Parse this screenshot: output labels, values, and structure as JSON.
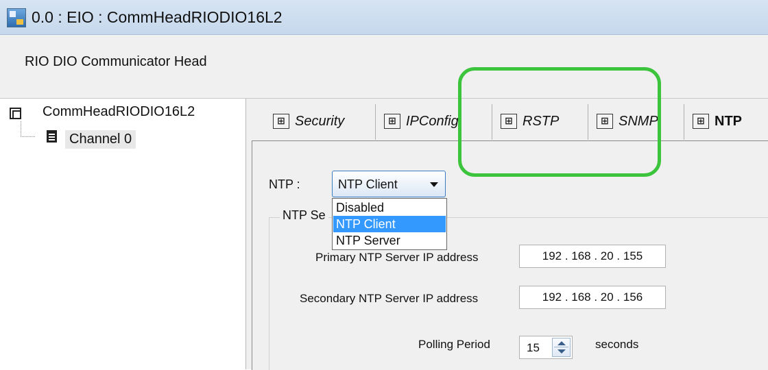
{
  "window": {
    "title": "0.0 : EIO : CommHeadRIODIO16L2"
  },
  "header": {
    "description": "RIO DIO Communicator Head"
  },
  "tree": {
    "root_label": "CommHeadRIODIO16L2",
    "child_label": "Channel 0"
  },
  "tabs": [
    {
      "label": "Security",
      "icon_glyph": "⟦⟧",
      "active": false
    },
    {
      "label": "IPConfig",
      "icon_glyph": "⟦⟧",
      "active": false
    },
    {
      "label": "RSTP",
      "icon_glyph": "⟦⟧",
      "active": false
    },
    {
      "label": "SNMP",
      "icon_glyph": "⟦⟧",
      "active": false
    },
    {
      "label": "NTP",
      "icon_glyph": "⟦⟧",
      "active": true
    }
  ],
  "ntp": {
    "label": "NTP :",
    "selected": "NTP Client",
    "options": [
      "Disabled",
      "NTP Client",
      "NTP Server"
    ]
  },
  "group": {
    "legend": "NTP Se"
  },
  "fields": {
    "primary_label": "Primary NTP Server IP address",
    "primary_value": "192 . 168 . 20 . 155",
    "secondary_label": "Secondary NTP Server IP address",
    "secondary_value": "192 . 168 . 20 . 156",
    "polling_label": "Polling Period",
    "polling_value": "15",
    "polling_unit": "seconds"
  },
  "colors": {
    "highlight": "#3cc43c",
    "selection": "#3399ff"
  }
}
